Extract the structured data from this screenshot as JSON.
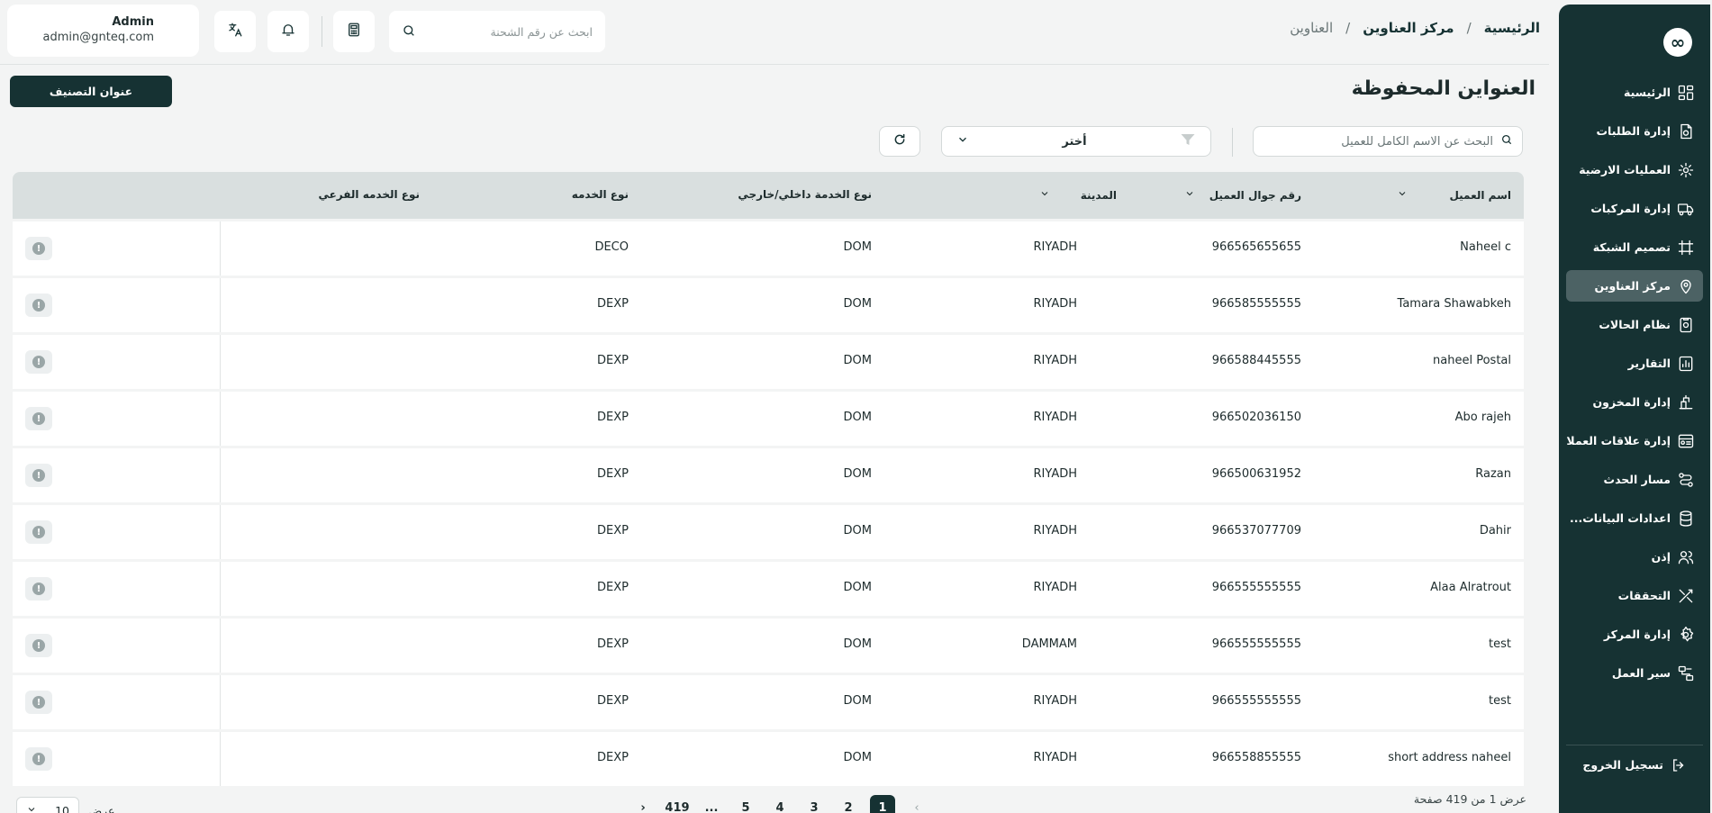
{
  "sidebar": {
    "logo_glyph": "∞",
    "items": [
      {
        "label": "الرئيسية",
        "icon": "dashboard-icon"
      },
      {
        "label": "إدارة الطلبات",
        "icon": "orders-icon"
      },
      {
        "label": "العمليات الارضية",
        "icon": "ground-ops-icon"
      },
      {
        "label": "إدارة المركبات",
        "icon": "truck-icon"
      },
      {
        "label": "تصميم الشبكة",
        "icon": "network-icon"
      },
      {
        "label": "مركز العناوين",
        "icon": "location-icon"
      },
      {
        "label": "نظام الحالات",
        "icon": "status-icon"
      },
      {
        "label": "التقارير",
        "icon": "reports-icon"
      },
      {
        "label": "إدارة المخزون",
        "icon": "inventory-icon"
      },
      {
        "label": "إدارة علاقات العملاء",
        "icon": "crm-icon"
      },
      {
        "label": "مسار الحدث",
        "icon": "route-icon"
      },
      {
        "label": "اعدادات البيانات...",
        "icon": "database-icon"
      },
      {
        "label": "إذن",
        "icon": "users-icon"
      },
      {
        "label": "التحققات",
        "icon": "checks-icon"
      },
      {
        "label": "إدارة المركز",
        "icon": "settings-icon"
      },
      {
        "label": "سير العمل",
        "icon": "workflow-icon"
      }
    ],
    "active_index": 5,
    "logout_label": "تسجيل الخروج"
  },
  "header": {
    "breadcrumb": [
      "الرئيسية",
      "مركز العناوين",
      "العناوين"
    ],
    "breadcrumb_sep": "/",
    "search_placeholder": "ابحث عن رقم الشحنة",
    "user": {
      "name": "Admin",
      "email": "admin@gnteq.com"
    }
  },
  "page": {
    "title": "العنواين المحفوظة",
    "primary_button": "عنوان التصنيف",
    "filter_search_placeholder": "البحث عن الاسم الكامل للعميل",
    "select_value": "أختر"
  },
  "table": {
    "headers": {
      "customer_name": "اسم العميل",
      "phone": "رقم جوال العميل",
      "city": "المدينة",
      "scope": "نوع الخدمة داخلي/خارجي",
      "service": "نوع الخدمه",
      "sub_service": "نوع الخدمه الفرعي"
    },
    "rows": [
      {
        "name": "Naheel c",
        "phone": "966565655655",
        "city": "RIYADH",
        "scope": "DOM",
        "service": "DECO",
        "sub": ""
      },
      {
        "name": "Tamara Shawabkeh",
        "phone": "966585555555",
        "city": "RIYADH",
        "scope": "DOM",
        "service": "DEXP",
        "sub": ""
      },
      {
        "name": "naheel Postal",
        "phone": "966588445555",
        "city": "RIYADH",
        "scope": "DOM",
        "service": "DEXP",
        "sub": ""
      },
      {
        "name": "Abo rajeh",
        "phone": "966502036150",
        "city": "RIYADH",
        "scope": "DOM",
        "service": "DEXP",
        "sub": ""
      },
      {
        "name": "Razan",
        "phone": "966500631952",
        "city": "RIYADH",
        "scope": "DOM",
        "service": "DEXP",
        "sub": ""
      },
      {
        "name": "Dahir",
        "phone": "966537077709",
        "city": "RIYADH",
        "scope": "DOM",
        "service": "DEXP",
        "sub": ""
      },
      {
        "name": "Alaa Alratrout",
        "phone": "966555555555",
        "city": "RIYADH",
        "scope": "DOM",
        "service": "DEXP",
        "sub": ""
      },
      {
        "name": "test",
        "phone": "966555555555",
        "city": "DAMMAM",
        "scope": "DOM",
        "service": "DEXP",
        "sub": ""
      },
      {
        "name": "test",
        "phone": "966555555555",
        "city": "RIYADH",
        "scope": "DOM",
        "service": "DEXP",
        "sub": ""
      },
      {
        "name": "short address naheel",
        "phone": "966558855555",
        "city": "RIYADH",
        "scope": "DOM",
        "service": "DEXP",
        "sub": ""
      }
    ],
    "row_action_glyph": "!"
  },
  "pagination": {
    "info": "عرض 1 من 419 صفحة",
    "pages": [
      "1",
      "2",
      "3",
      "4",
      "5",
      "...",
      "419"
    ],
    "active_page": "1",
    "prev_glyph": "‹",
    "next_glyph": "›",
    "per_page_label": "عرض",
    "per_page_value": "10"
  },
  "colors": {
    "brand": "#163233",
    "active_nav": "#4c6264",
    "background": "#f3f4f4"
  }
}
